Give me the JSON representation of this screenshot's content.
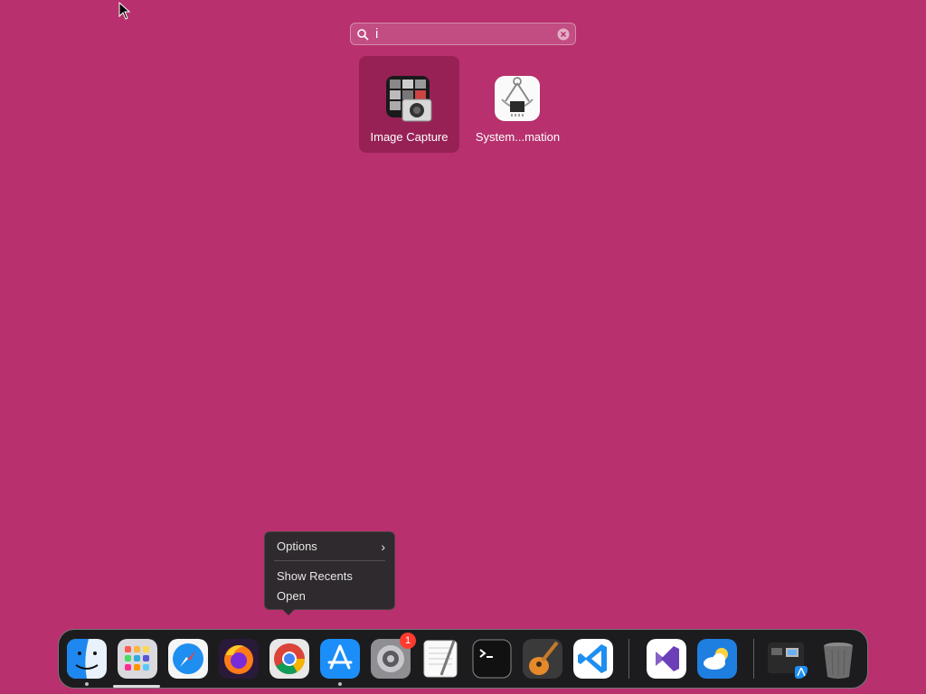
{
  "search": {
    "query": "i"
  },
  "results": [
    {
      "label": "Image Capture",
      "icon": "image-capture-icon",
      "selected": true
    },
    {
      "label": "System...mation",
      "icon": "system-information-icon",
      "selected": false
    }
  ],
  "context_menu": {
    "items": [
      "Options",
      "Show Recents",
      "Open"
    ]
  },
  "dock": {
    "apps": [
      "finder-icon",
      "launchpad-icon",
      "safari-icon",
      "firefox-icon",
      "chrome-icon",
      "app-store-icon",
      "system-settings-icon",
      "textedit-icon",
      "terminal-icon",
      "garageband-icon",
      "vscode-icon",
      "visual-studio-icon",
      "weather-icon",
      "downloads-stack-icon",
      "trash-icon"
    ],
    "settings_badge": "1"
  },
  "colors": {
    "wallpaper": "#b8306e",
    "menu_bg": "#2f2a2d",
    "badge": "#ff3b30"
  }
}
